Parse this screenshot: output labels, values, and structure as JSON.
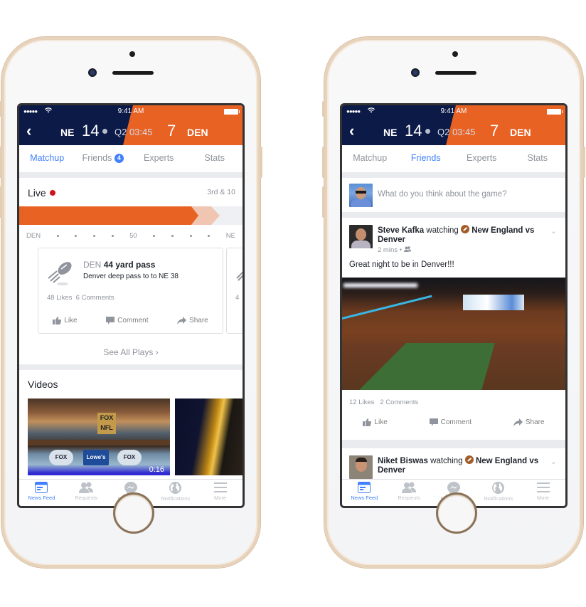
{
  "phones": {
    "left": {
      "status": {
        "time": "9:41 AM",
        "signal": "●●●●●",
        "wifi": "wifi"
      },
      "score": {
        "back": "‹",
        "home_team": "NE",
        "home_score": "14",
        "period_clock": "Q2 03:45",
        "away_score": "7",
        "away_team": "DEN"
      },
      "tabs": [
        {
          "label": "Matchup",
          "active": true
        },
        {
          "label": "Friends",
          "badge": "4",
          "active": false
        },
        {
          "label": "Experts",
          "active": false
        },
        {
          "label": "Stats",
          "active": false
        }
      ],
      "live": {
        "label": "Live",
        "down_distance": "3rd & 10",
        "drive_progress_pct": 78,
        "projected_pct": 87
      },
      "yard_line": {
        "left": "DEN",
        "mid": "50",
        "right": "NE"
      },
      "play": {
        "team": "DEN",
        "title": "44 yard pass",
        "description": "Denver deep pass to to NE 38",
        "likes": "48 Likes",
        "comments": "6 Comments",
        "actions": [
          "Like",
          "Comment",
          "Share"
        ],
        "peek_stat": "4"
      },
      "see_all": "See All Plays  ›",
      "videos": {
        "title": "Videos",
        "items": [
          {
            "duration": "0:16",
            "logo": "FOX NFL",
            "panel_logos": [
              "FOX",
              "Lowe's",
              "FOX"
            ]
          },
          {
            "duration": ""
          }
        ]
      }
    },
    "right": {
      "status": {
        "time": "9:41 AM",
        "signal": "●●●●●",
        "wifi": "wifi"
      },
      "score": {
        "back": "‹",
        "home_team": "NE",
        "home_score": "14",
        "period_clock": "Q2 03:45",
        "away_score": "7",
        "away_team": "DEN"
      },
      "tabs": [
        {
          "label": "Matchup",
          "active": false
        },
        {
          "label": "Friends",
          "active": true
        },
        {
          "label": "Experts",
          "active": false
        },
        {
          "label": "Stats",
          "active": false
        }
      ],
      "composer": {
        "placeholder": "What do you think about the game?"
      },
      "posts": [
        {
          "author": "Steve Kafka",
          "verb": "watching",
          "event": "New England vs Denver",
          "time": "2 mins",
          "privacy": "friends",
          "text": "Great night to be in Denver!!!",
          "likes": "12 Likes",
          "comments": "2 Comments",
          "actions": [
            "Like",
            "Comment",
            "Share"
          ]
        },
        {
          "author": "Niket Biswas",
          "verb": "watching",
          "event": "New England vs Denver"
        }
      ]
    }
  },
  "tabbar": [
    {
      "label": "News Feed",
      "icon": "news-feed-icon",
      "active": true
    },
    {
      "label": "Requests",
      "icon": "friend-requests-icon",
      "active": false
    },
    {
      "label": "Messenger",
      "icon": "messenger-icon",
      "active": false
    },
    {
      "label": "Notifications",
      "icon": "globe-icon",
      "active": false
    },
    {
      "label": "More",
      "icon": "menu-icon",
      "active": false
    }
  ],
  "colors": {
    "navy": "#0c1a48",
    "orange": "#e86224",
    "accent_blue": "#4080ff",
    "muted_gray": "#90949c",
    "live_red": "#d0121b"
  }
}
